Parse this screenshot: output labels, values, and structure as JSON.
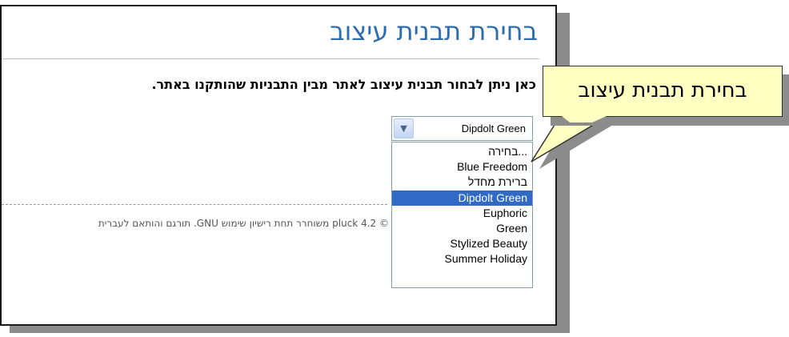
{
  "page": {
    "title": "בחירת תבנית עיצוב",
    "description": "כאן ניתן לבחור תבנית עיצוב לאתר מבין התבניות שהותקנו באתר.",
    "footer": "© pluck 4.2 משוחרר תחת רישיון שימוש GNU. תורגם והותאם לעברית"
  },
  "select": {
    "value": "Dipdolt Green",
    "options": [
      "בחירה...",
      "Blue Freedom",
      "ברירת מחדל",
      "Dipdolt Green",
      "Euphoric",
      "Green",
      "Stylized Beauty",
      "Summer Holiday"
    ],
    "selected_index": 3,
    "highlight_color": "#316ac5"
  },
  "callout": {
    "text": "בחירת תבנית עיצוב",
    "fill_color": "#ffffc2"
  },
  "colors": {
    "title": "#2e6dad"
  }
}
